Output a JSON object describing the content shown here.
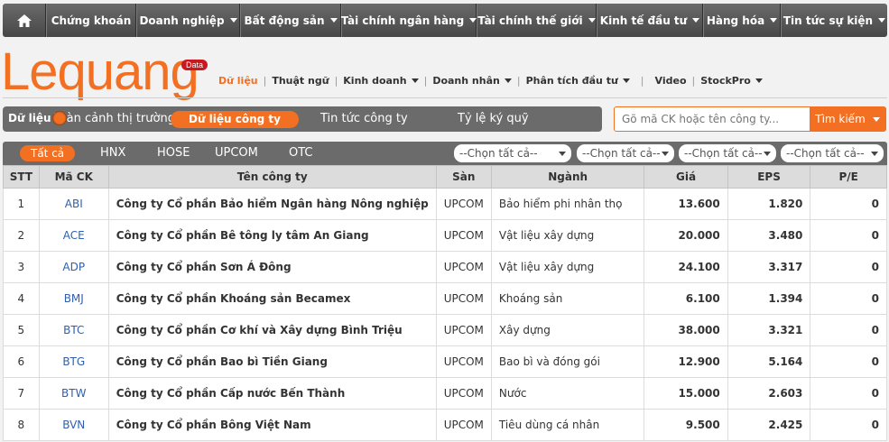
{
  "topnav": {
    "home_icon": "home-icon",
    "items": [
      {
        "label": "Chứng khoán",
        "dropdown": false
      },
      {
        "label": "Doanh nghiệp",
        "dropdown": true
      },
      {
        "label": "Bất động sản",
        "dropdown": true
      },
      {
        "label": "Tài chính ngân hàng",
        "dropdown": true
      },
      {
        "label": "Tài chính thế giới",
        "dropdown": true
      },
      {
        "label": "Kinh tế đầu tư",
        "dropdown": true
      },
      {
        "label": "Hàng hóa",
        "dropdown": true
      },
      {
        "label": "Tin tức sự kiện",
        "dropdown": true
      }
    ]
  },
  "logo": {
    "text": "Lequang",
    "badge": "Data"
  },
  "subnav": {
    "items": [
      {
        "label": "Dữ liệu",
        "active": true
      },
      {
        "label": "Thuật ngữ"
      },
      {
        "label": "Kinh doanh",
        "dropdown": true
      },
      {
        "label": "Doanh nhân",
        "dropdown": true
      },
      {
        "label": "Phân tích đầu tư",
        "dropdown": true
      },
      {
        "label": "Video"
      },
      {
        "label": "StockPro",
        "dropdown": true
      }
    ]
  },
  "databar": {
    "label": "Dữ liệu",
    "tabs": [
      "Toàn cảnh thị trường",
      "Dữ liệu công ty",
      "Tin tức công ty",
      "Tỷ lệ ký quỹ"
    ],
    "active_tab": "Dữ liệu công ty"
  },
  "search": {
    "placeholder": "Gõ mã CK hoặc tên công ty...",
    "button": "Tìm kiếm"
  },
  "exchange_tabs": [
    "Tất cả",
    "HNX",
    "HOSE",
    "UPCOM",
    "OTC"
  ],
  "filters": [
    "--Chọn tất cả--",
    "--Chọn tất cả--",
    "--Chọn tất cả--",
    "--Chọn tất cả--"
  ],
  "table": {
    "headers": [
      "STT",
      "Mã CK",
      "Tên công ty",
      "Sàn",
      "Ngành",
      "Giá",
      "EPS",
      "P/E"
    ],
    "rows": [
      [
        "1",
        "ABI",
        "Công ty Cổ phần Bảo hiểm Ngân hàng Nông nghiệp",
        "UPCOM",
        "Bảo hiểm phi nhân thọ",
        "13.600",
        "1.820",
        "0"
      ],
      [
        "2",
        "ACE",
        "Công ty Cổ phần Bê tông ly tâm An Giang",
        "UPCOM",
        "Vật liệu xây dựng",
        "20.000",
        "3.480",
        "0"
      ],
      [
        "3",
        "ADP",
        "Công ty Cổ phần Sơn Á Đông",
        "UPCOM",
        "Vật liệu xây dựng",
        "24.100",
        "3.317",
        "0"
      ],
      [
        "4",
        "BMJ",
        "Công ty Cổ phần Khoáng sản Becamex",
        "UPCOM",
        "Khoáng sản",
        "6.100",
        "1.394",
        "0"
      ],
      [
        "5",
        "BTC",
        "Công ty Cổ phần Cơ khí và Xây dựng Bình Triệu",
        "UPCOM",
        "Xây dựng",
        "38.000",
        "3.321",
        "0"
      ],
      [
        "6",
        "BTG",
        "Công ty Cổ phần Bao bì Tiền Giang",
        "UPCOM",
        "Bao bì và đóng gói",
        "12.900",
        "5.164",
        "0"
      ],
      [
        "7",
        "BTW",
        "Công ty Cổ phần Cấp nước Bến Thành",
        "UPCOM",
        "Nước",
        "15.000",
        "2.603",
        "0"
      ],
      [
        "8",
        "BVN",
        "Công ty Cổ phần Bông Việt Nam",
        "UPCOM",
        "Tiêu dùng cá nhân",
        "9.500",
        "2.425",
        "0"
      ]
    ]
  },
  "colors": {
    "accent": "#f36f21",
    "nav_bg": "#555555",
    "badge": "#c8191f",
    "code_link": "#2f5fae"
  }
}
